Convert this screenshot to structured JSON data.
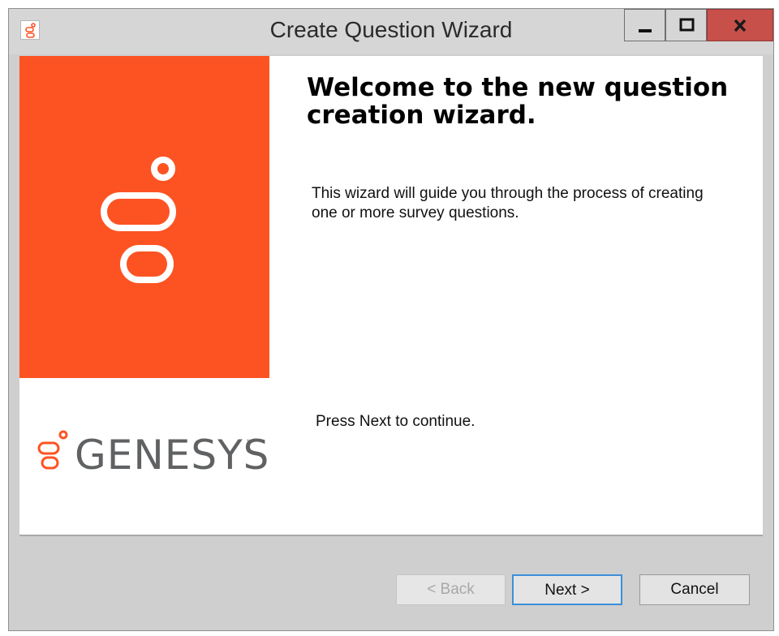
{
  "window": {
    "title": "Create Question Wizard"
  },
  "banner": {
    "brand_color": "#fd5323",
    "icon": "genesys-logo-icon"
  },
  "logo": {
    "wordmark": "GENESYS",
    "trademark": "™",
    "icon": "genesys-logo-icon"
  },
  "main": {
    "title": "Welcome to the new question creation wizard.",
    "intro": "This wizard will guide you through the process of creating one or more survey questions.",
    "continue_hint": "Press Next to continue."
  },
  "buttons": {
    "back_label": "< Back",
    "next_label": "Next >",
    "cancel_label": "Cancel"
  },
  "titlebar_controls": {
    "minimize_icon": "minimize-icon",
    "maximize_icon": "maximize-icon",
    "close_icon": "close-icon",
    "close_color": "#c7504a"
  }
}
